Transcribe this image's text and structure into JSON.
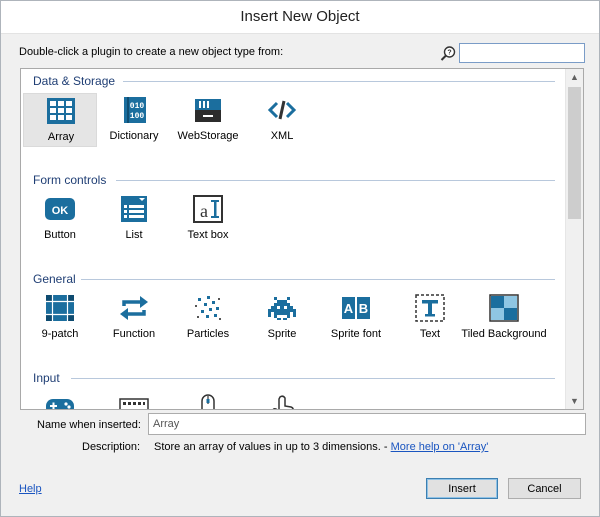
{
  "window": {
    "title": "Insert New Object"
  },
  "instructions": "Double-click a plugin to create a new object type from:",
  "search": {
    "value": "",
    "placeholder": ""
  },
  "categories": [
    {
      "name": "Data & Storage",
      "items": [
        {
          "label": "Array",
          "icon": "array-icon",
          "selected": true
        },
        {
          "label": "Dictionary",
          "icon": "dictionary-icon"
        },
        {
          "label": "WebStorage",
          "icon": "webstorage-icon"
        },
        {
          "label": "XML",
          "icon": "xml-icon"
        }
      ]
    },
    {
      "name": "Form controls",
      "items": [
        {
          "label": "Button",
          "icon": "button-icon"
        },
        {
          "label": "List",
          "icon": "list-icon"
        },
        {
          "label": "Text box",
          "icon": "textbox-icon"
        }
      ]
    },
    {
      "name": "General",
      "items": [
        {
          "label": "9-patch",
          "icon": "ninepatch-icon"
        },
        {
          "label": "Function",
          "icon": "function-icon"
        },
        {
          "label": "Particles",
          "icon": "particles-icon"
        },
        {
          "label": "Sprite",
          "icon": "sprite-icon"
        },
        {
          "label": "Sprite font",
          "icon": "spritefont-icon"
        },
        {
          "label": "Text",
          "icon": "text-icon"
        },
        {
          "label": "Tiled Background",
          "icon": "tiledbg-icon"
        }
      ]
    },
    {
      "name": "Input",
      "items": [
        {
          "label": "",
          "icon": "gamepad-icon"
        },
        {
          "label": "",
          "icon": "keyboard-icon"
        },
        {
          "label": "",
          "icon": "mouse-icon"
        },
        {
          "label": "",
          "icon": "touch-icon"
        }
      ]
    }
  ],
  "name_field": {
    "label": "Name when inserted:",
    "value": "Array"
  },
  "description": {
    "label": "Description:",
    "text": "Store an array of values in up to 3 dimensions. - ",
    "link": "More help on 'Array'"
  },
  "footer": {
    "help": "Help",
    "insert": "Insert",
    "cancel": "Cancel"
  },
  "colors": {
    "icon_accent": "#1b6e9e",
    "link": "#1a55c0",
    "category": "#1f3e74"
  }
}
